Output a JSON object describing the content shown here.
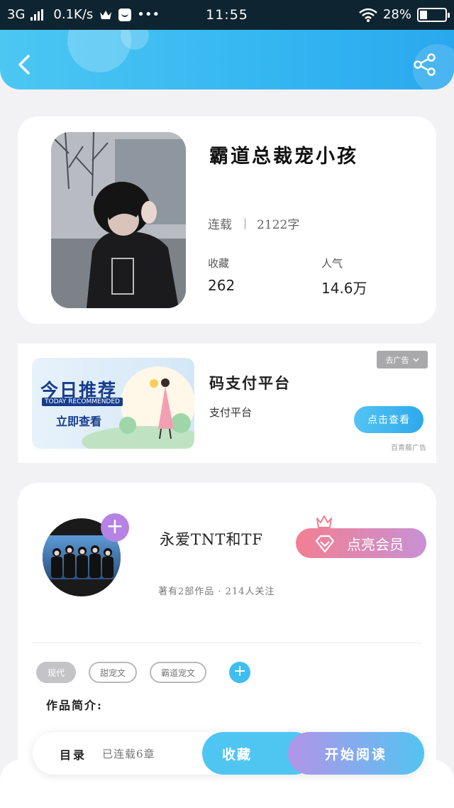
{
  "status_bar": {
    "network": "3G",
    "speed": "0.1K/s",
    "time": "11:55",
    "battery": "28%",
    "more": "•••"
  },
  "header": {
    "back_icon": "chevron-left-icon",
    "share_icon": "share-icon",
    "gradient": [
      "#4cc7f2",
      "#2aa8ee"
    ]
  },
  "book": {
    "title": "霸道总裁宠小孩",
    "status": "连载",
    "word_count": "2122字",
    "favorites_label": "收藏",
    "favorites_value": "262",
    "popularity_label": "人气",
    "popularity_value": "14.6万"
  },
  "ad": {
    "image_headline": "今日推荐",
    "image_sub": "TODAY RECOMMENDED",
    "image_cta": "立即查看",
    "title": "码支付平台",
    "subtitle": "支付平台",
    "close_label": "去广告",
    "button_label": "点击查看",
    "source": "百青藤广告"
  },
  "author": {
    "name": "永爱TNT和TF",
    "meta": "著有2部作品 · 214人关注",
    "follow_symbol": "+",
    "vip_label": "点亮会员",
    "tags": [
      "现代",
      "甜宠文",
      "霸道宠文"
    ],
    "tag_add_symbol": "+",
    "intro_label": "作品简介:"
  },
  "bottom_bar": {
    "toc_label": "目录",
    "toc_info": "已连载6章",
    "favorite_label": "收藏",
    "read_label": "开始阅读"
  },
  "colors": {
    "accent": "#3fbef0",
    "vip_start": "#f27f92",
    "vip_end": "#c891d4",
    "status_bar": "#0f2431"
  }
}
